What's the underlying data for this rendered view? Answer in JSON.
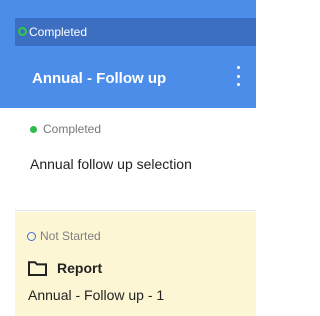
{
  "header": {
    "status": "Completed",
    "title": "Annual - Follow up",
    "menu_icon": "kebab-menu-icon",
    "status_icon": "ring-icon",
    "colors": {
      "background": "#4b8de8",
      "status_bar": "#3c6fc2",
      "ring": "#2ecc40"
    }
  },
  "items": [
    {
      "status": "Completed",
      "status_icon": "dot-icon",
      "title": "Annual follow up selection",
      "color": "#2ebd4a"
    },
    {
      "status": "Not Started",
      "status_icon": "ring-icon",
      "type_icon": "folder-icon",
      "type": "Report",
      "title": "Annual - Follow up - 1",
      "background": "#fdf6d4",
      "ring_color": "#3a6fd8"
    }
  ]
}
